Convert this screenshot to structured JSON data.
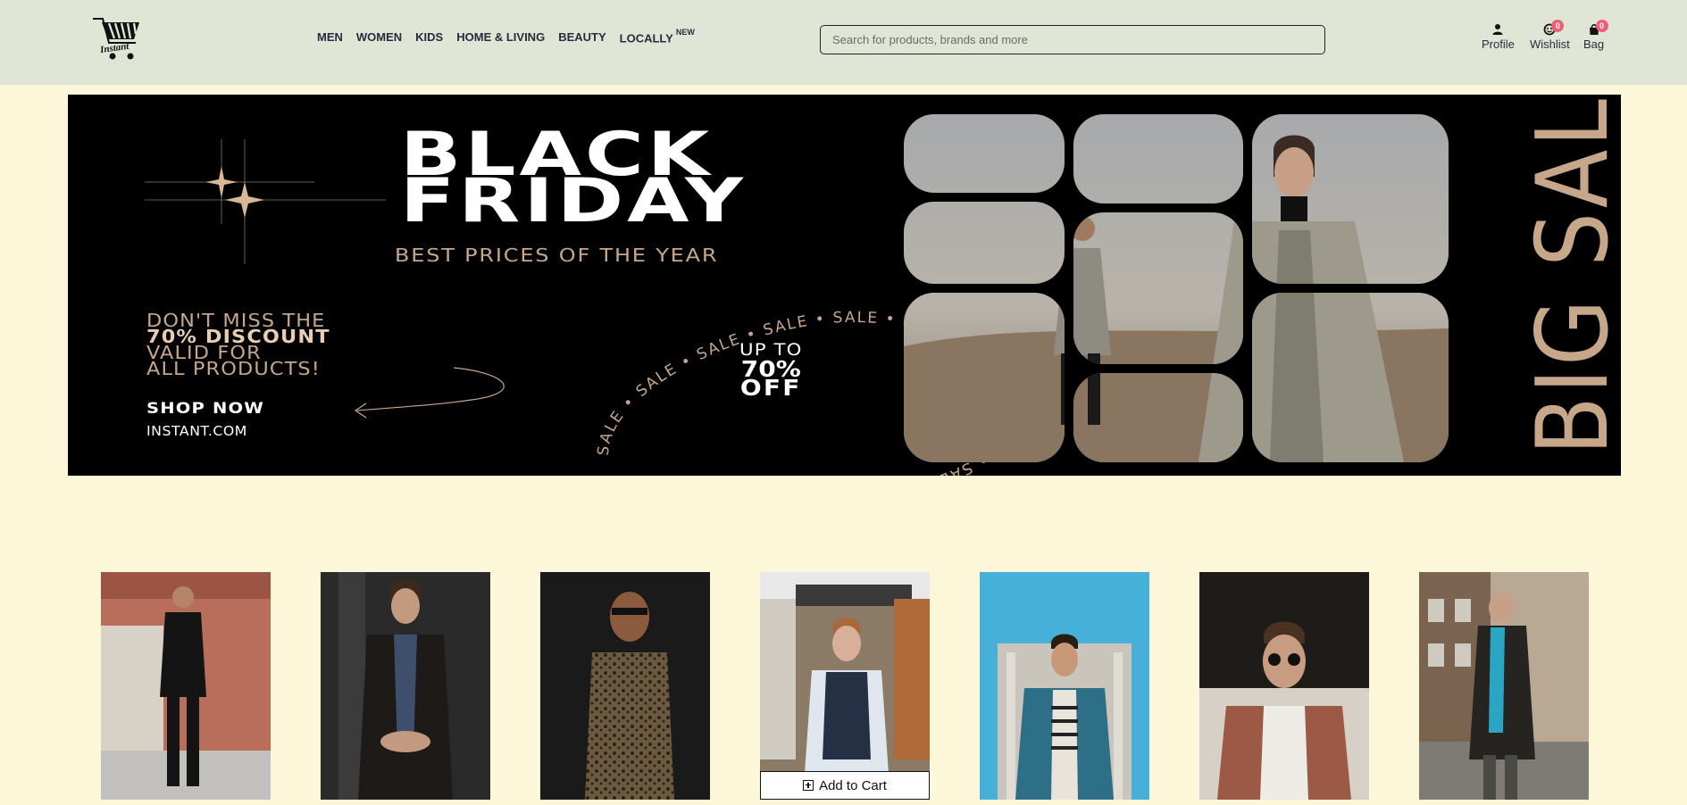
{
  "header": {
    "logo_text": "Instant",
    "nav": [
      {
        "label": "MEN",
        "tag": ""
      },
      {
        "label": "WOMEN",
        "tag": ""
      },
      {
        "label": "KIDS",
        "tag": ""
      },
      {
        "label": "HOME & LIVING",
        "tag": ""
      },
      {
        "label": "BEAUTY",
        "tag": ""
      },
      {
        "label": "LOCALLY",
        "tag": "NEW"
      }
    ],
    "search_placeholder": "Search for products, brands and more",
    "actions": {
      "profile": {
        "label": "Profile",
        "icon": "person-icon"
      },
      "wishlist": {
        "label": "Wishlist",
        "icon": "heart-icon",
        "count": "0"
      },
      "bag": {
        "label": "Bag",
        "icon": "bag-icon",
        "count": "0"
      }
    },
    "badge_color": "#ee5f73"
  },
  "banner": {
    "title_line1": "BLACK",
    "title_line2": "FRIDAY",
    "subtitle": "BEST PRICES OF THE YEAR",
    "promo_line1": "DON'T MISS THE",
    "promo_line2": "70% DISCOUNT",
    "promo_line3": "VALID FOR",
    "promo_line4": "ALL PRODUCTS!",
    "cta": "SHOP NOW",
    "site": "INSTANT.COM",
    "offer_line1": "UP TO",
    "offer_line2": "70%",
    "offer_line3": "OFF",
    "ring_text": "SALE • SALE • SALE • SALE • SALE • SALE • SALE • SALE • SALE • SALE •",
    "vertical_text": "BIG SALE",
    "accent_color": "#c7a78a"
  },
  "products": [
    {
      "name": "product-1",
      "cart_visible": false
    },
    {
      "name": "product-2",
      "cart_visible": false
    },
    {
      "name": "product-3",
      "cart_visible": false
    },
    {
      "name": "product-4",
      "cart_visible": true
    },
    {
      "name": "product-5",
      "cart_visible": false
    },
    {
      "name": "product-6",
      "cart_visible": false
    },
    {
      "name": "product-7",
      "cart_visible": false
    }
  ],
  "add_to_cart_label": "Add to Cart"
}
